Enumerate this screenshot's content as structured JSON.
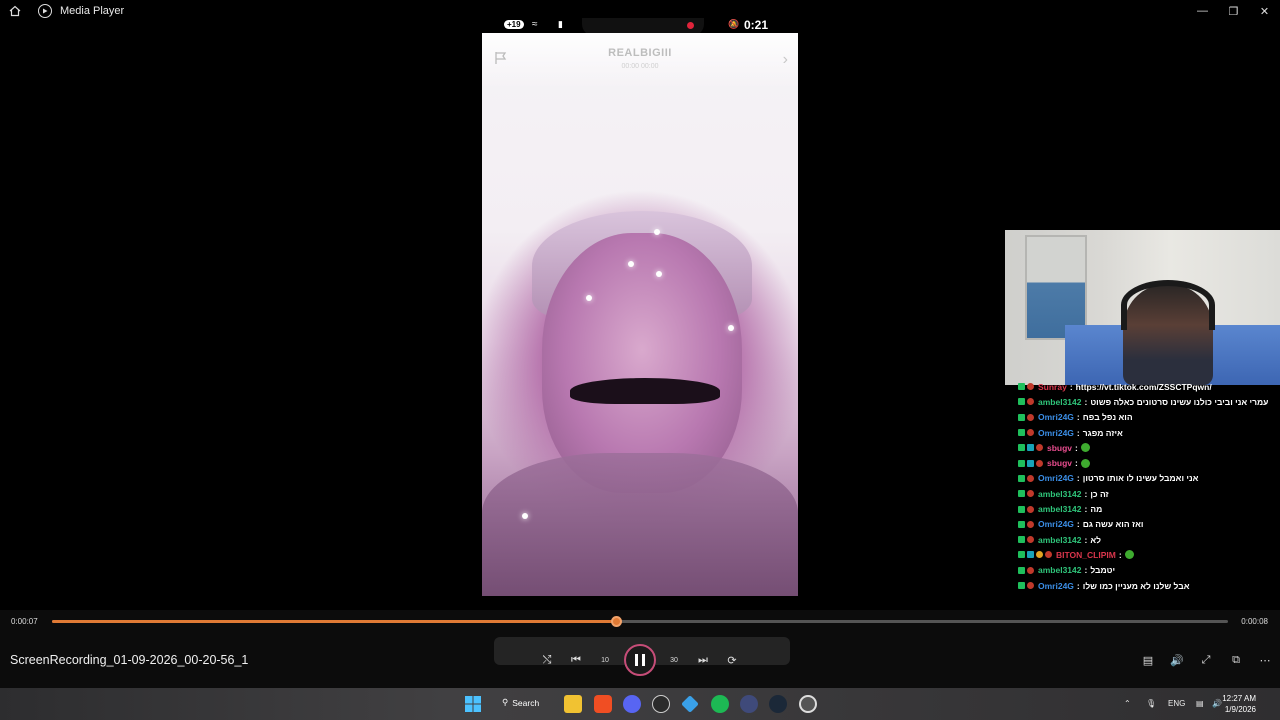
{
  "window": {
    "title": "Media Player"
  },
  "phone_status": {
    "badge": "+19",
    "time": "0:21"
  },
  "video_overlay": {
    "username": "REALBIGIII",
    "subtitle": "00:00 00:00"
  },
  "chat": [
    {
      "user": "Sunray",
      "user_color": "#d9364c",
      "msg": "https://vt.tiktok.com/ZSSCTPqwn/",
      "badges": [
        "green",
        "mod"
      ]
    },
    {
      "user": "ambel3142",
      "user_color": "#2fc47a",
      "msg": "עמרי אני וביבי כולנו עשינו סרטונים כאלה פשוט",
      "badges": [
        "green",
        "mod"
      ]
    },
    {
      "user": "Omri24G",
      "user_color": "#3b8ee6",
      "msg": "הוא נפל בפח",
      "badges": [
        "green",
        "mod"
      ]
    },
    {
      "user": "Omri24G",
      "user_color": "#3b8ee6",
      "msg": "איזה מפגר",
      "badges": [
        "green",
        "mod"
      ]
    },
    {
      "user": "sbugv",
      "user_color": "#e94d8f",
      "msg": "",
      "emote": true,
      "badges": [
        "green",
        "teal",
        "mod"
      ]
    },
    {
      "user": "sbugv",
      "user_color": "#e94d8f",
      "msg": "",
      "emote": true,
      "badges": [
        "green",
        "teal",
        "mod"
      ]
    },
    {
      "user": "Omri24G",
      "user_color": "#3b8ee6",
      "msg": "אני ואמבל עשינו לו אותו סרטון",
      "badges": [
        "green",
        "mod"
      ]
    },
    {
      "user": "ambel3142",
      "user_color": "#2fc47a",
      "msg": "זה כן",
      "badges": [
        "green",
        "mod"
      ]
    },
    {
      "user": "ambel3142",
      "user_color": "#2fc47a",
      "msg": "מה",
      "badges": [
        "green",
        "mod"
      ]
    },
    {
      "user": "Omri24G",
      "user_color": "#3b8ee6",
      "msg": "ואז הוא עשה גם",
      "badges": [
        "green",
        "mod"
      ]
    },
    {
      "user": "ambel3142",
      "user_color": "#2fc47a",
      "msg": "לא",
      "badges": [
        "green",
        "mod"
      ]
    },
    {
      "user": "BITON_CLIPIM",
      "user_color": "#d9364c",
      "msg": "",
      "emote": true,
      "badges": [
        "green",
        "teal",
        "gold",
        "mod"
      ]
    },
    {
      "user": "ambel3142",
      "user_color": "#2fc47a",
      "msg": "יטמבל",
      "badges": [
        "green",
        "mod"
      ]
    },
    {
      "user": "Omri24G",
      "user_color": "#3b8ee6",
      "msg": "אבל שלנו לא מעניין כמו שלו",
      "badges": [
        "green",
        "mod"
      ]
    }
  ],
  "playback": {
    "current_time": "0:00:07",
    "total_time": "0:00:08",
    "progress": 0.48,
    "file_name": "ScreenRecording_01-09-2026_00-20-56_1",
    "skip_back_label": "10",
    "skip_fwd_label": "30"
  },
  "taskbar": {
    "search_label": "Search",
    "language": "ENG",
    "time": "12:27 AM",
    "date": "1/9/2026"
  },
  "colors": {
    "accent": "#e07a35",
    "play_ring": "#c64d78"
  }
}
